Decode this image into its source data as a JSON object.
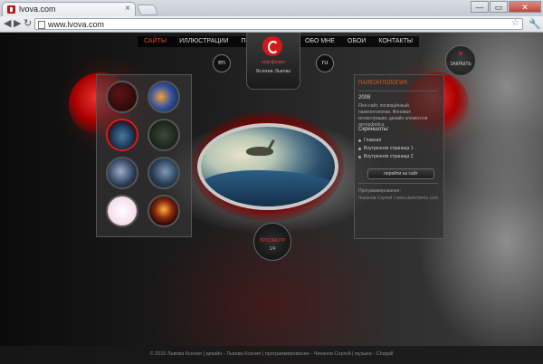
{
  "browser": {
    "tab_title": "lvova.com",
    "tab_close": "×",
    "url": "www.lvova.com",
    "back": "◀",
    "forward": "▶",
    "reload": "↻",
    "star": "☆",
    "wrench": "🔧",
    "window_buttons": [
      "—",
      "▭",
      "✕"
    ]
  },
  "site": {
    "nav_left": [
      "САЙТЫ",
      "ИЛЛЮСТРАЦИИ",
      "ПОЛИГРАФИЯ"
    ],
    "nav_right": [
      "ОБО МНЕ",
      "ОБОИ",
      "КОНТАКТЫ"
    ],
    "logo_sub": "портфолио",
    "logo_name": "Ксения Львова",
    "lang_en": "en",
    "lang_ru": "ru",
    "close_x": "✕",
    "close_label": "ЗАКРЫТЬ",
    "view_label": "ПРОСМОТР",
    "view_count": "1/4"
  },
  "info": {
    "title": "ПАЛЕОНТОЛОГИЯ",
    "year": "2008",
    "description": "Flex-сайт, посвящённый палеонтологии. Фоновая иллюстрация, дизайн элементов интерфейса.",
    "screenshots_label": "Скриншоты:",
    "screenshots": [
      "Главная",
      "Внутренняя страница 1",
      "Внутренняя страница 2"
    ],
    "goto_label": "перейти на сайт",
    "programming_label": "Программирование:",
    "programmer": "Чеканов Сергей | www.darkclients.com"
  },
  "footer": {
    "text": "© 2010 Львова Ксения  |  дизайн - Львова Ксения  |  программирование - Чеканов Сергей  |  музыка - Chagall"
  }
}
